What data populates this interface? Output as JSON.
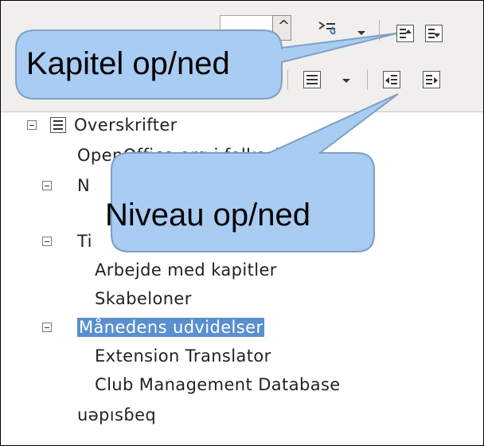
{
  "toolbar": {
    "spin_value": "",
    "icons": [
      "cut-like-icon",
      "chapter-up-icon",
      "chapter-down-icon",
      "list-icon",
      "promote-level-icon",
      "demote-level-icon"
    ]
  },
  "tree": {
    "items": [
      {
        "label": "Overskrifter"
      },
      {
        "label": "OpenOffice.org i folkeskolen"
      },
      {
        "label": "N"
      },
      {
        "label": "Ti"
      },
      {
        "label": "Arbejde med kapitler"
      },
      {
        "label": "Skabeloner"
      },
      {
        "label": "Månedens udvidelser"
      },
      {
        "label": "Extension Translator"
      },
      {
        "label": "Club Management Database"
      },
      {
        "label": "uəpısɓeq"
      }
    ]
  },
  "callouts": {
    "chapter": "Kapitel op/ned",
    "level": "Niveau op/ned"
  },
  "colors": {
    "callout_fill": "#a9ccf2",
    "callout_stroke": "#7f9fc4",
    "selection": "#5a8fcf"
  }
}
